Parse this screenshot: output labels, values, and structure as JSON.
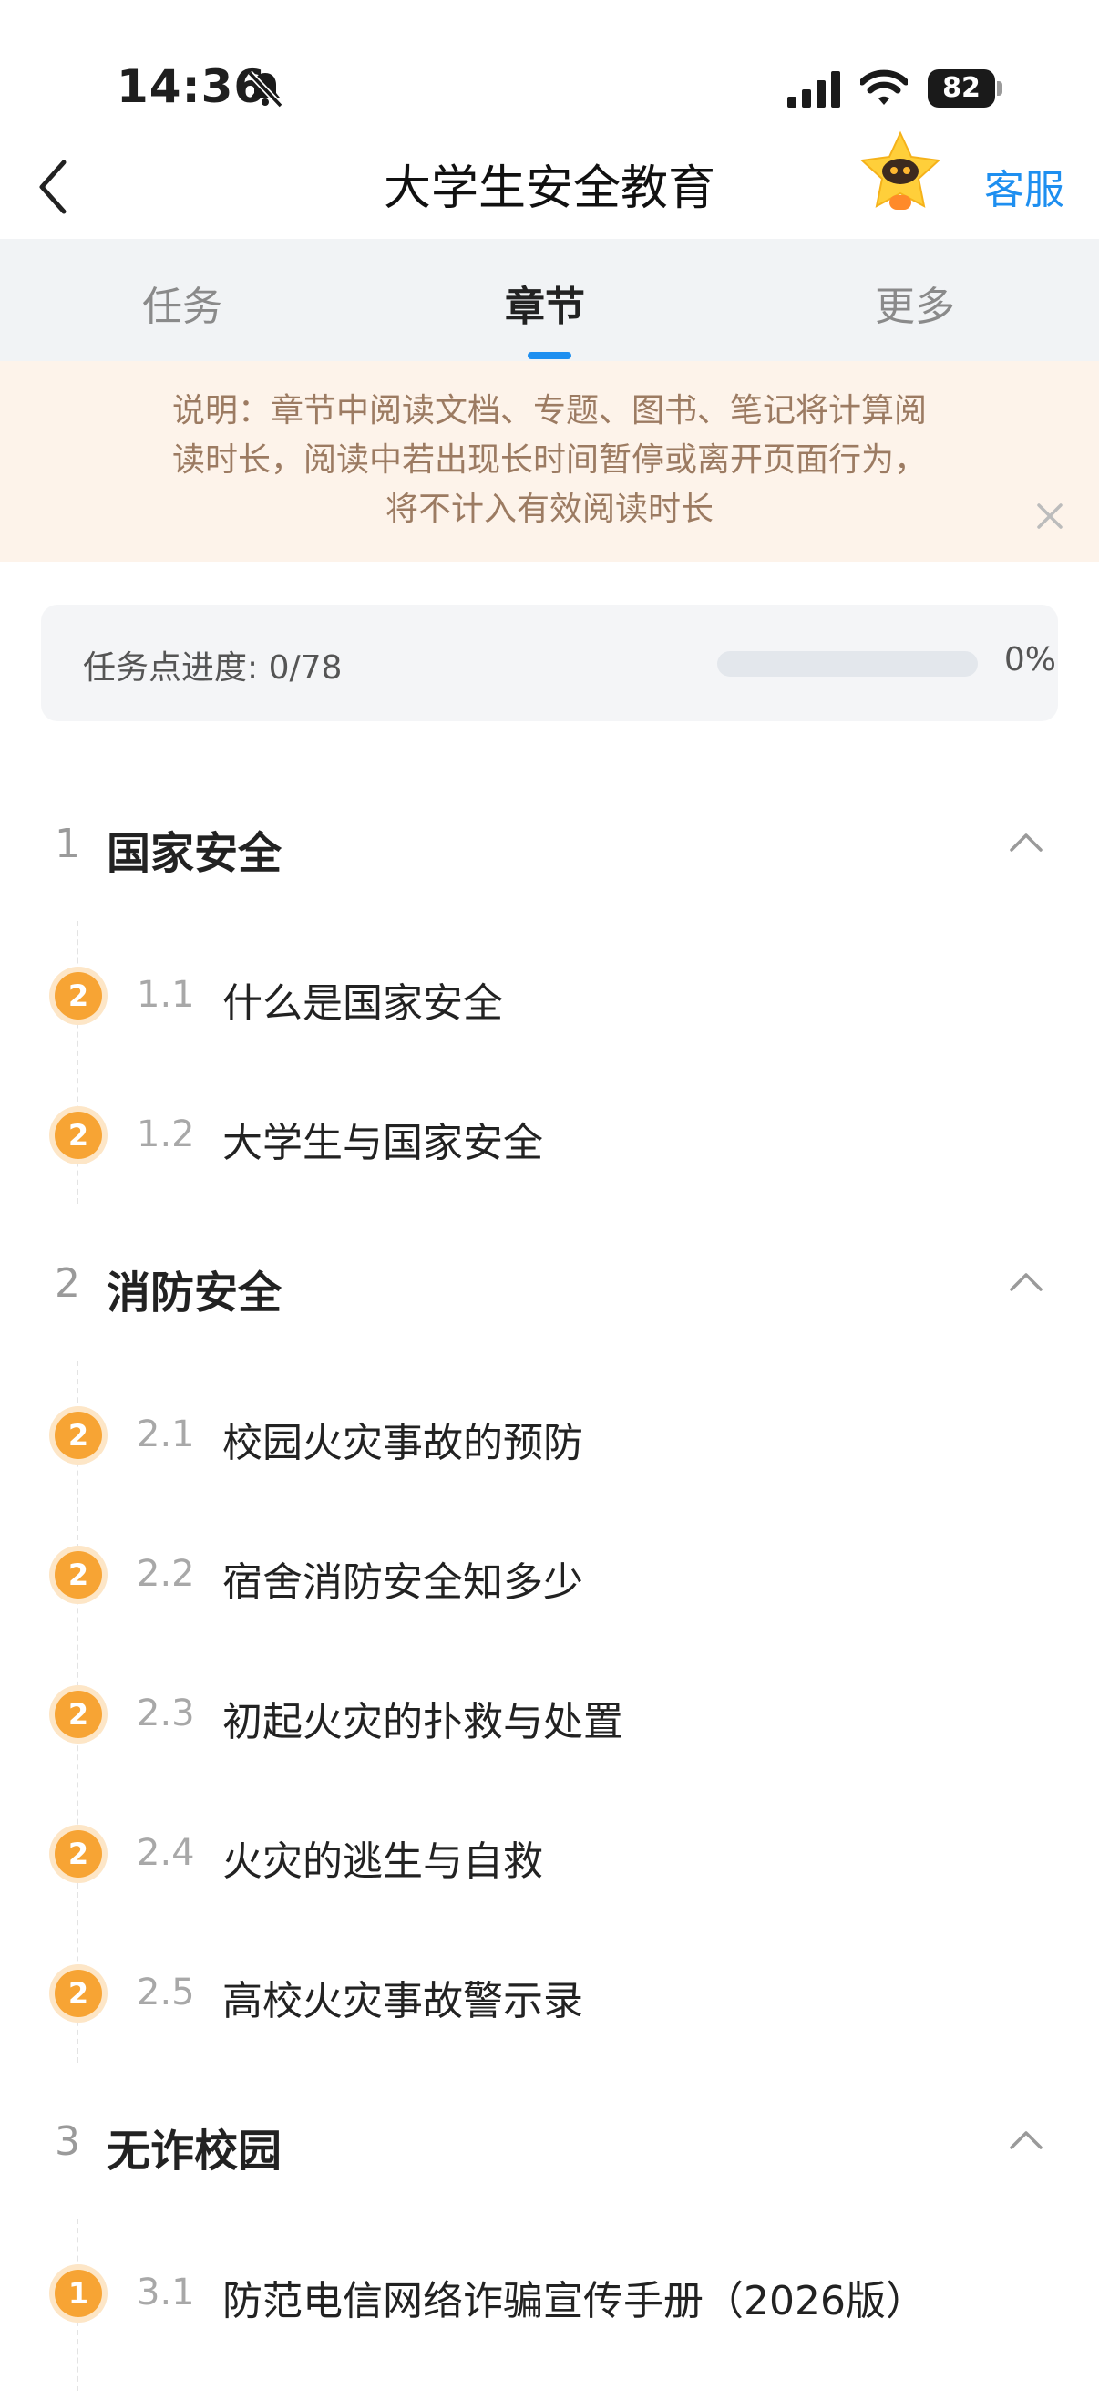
{
  "status_bar": {
    "time": "14:36",
    "battery": "82",
    "icons": [
      "bell-slash-icon",
      "signal-icon",
      "wifi-icon",
      "battery-icon"
    ]
  },
  "nav": {
    "title": "大学生安全教育",
    "service_label": "客服"
  },
  "tabs": [
    {
      "label": "任务",
      "active": false
    },
    {
      "label": "章节",
      "active": true
    },
    {
      "label": "更多",
      "active": false
    }
  ],
  "notice": {
    "line1": "说明：章节中阅读文档、专题、图书、笔记将计算阅",
    "line2": "读时长，阅读中若出现长时间暂停或离开页面行为，",
    "line3": "将不计入有效阅读时长"
  },
  "progress": {
    "label": "任务点进度: 0/78",
    "percent_text": "0%",
    "fraction": 0.0
  },
  "colors": {
    "accent": "#1e8ff0",
    "badge": "#f7a434",
    "notice_bg": "#fdf3ea",
    "notice_text": "#9c7b62"
  },
  "chapters": [
    {
      "num": "1",
      "title": "国家安全",
      "sections": [
        {
          "badge": "2",
          "num": "1.1",
          "title": "什么是国家安全"
        },
        {
          "badge": "2",
          "num": "1.2",
          "title": "大学生与国家安全"
        }
      ]
    },
    {
      "num": "2",
      "title": "消防安全",
      "sections": [
        {
          "badge": "2",
          "num": "2.1",
          "title": "校园火灾事故的预防"
        },
        {
          "badge": "2",
          "num": "2.2",
          "title": "宿舍消防安全知多少"
        },
        {
          "badge": "2",
          "num": "2.3",
          "title": "初起火灾的扑救与处置"
        },
        {
          "badge": "2",
          "num": "2.4",
          "title": "火灾的逃生与自救"
        },
        {
          "badge": "2",
          "num": "2.5",
          "title": "高校火灾事故警示录"
        }
      ]
    },
    {
      "num": "3",
      "title": "无诈校园",
      "sections": [
        {
          "badge": "1",
          "num": "3.1",
          "title": "防范电信网络诈骗宣传手册（2026版）"
        }
      ]
    }
  ]
}
